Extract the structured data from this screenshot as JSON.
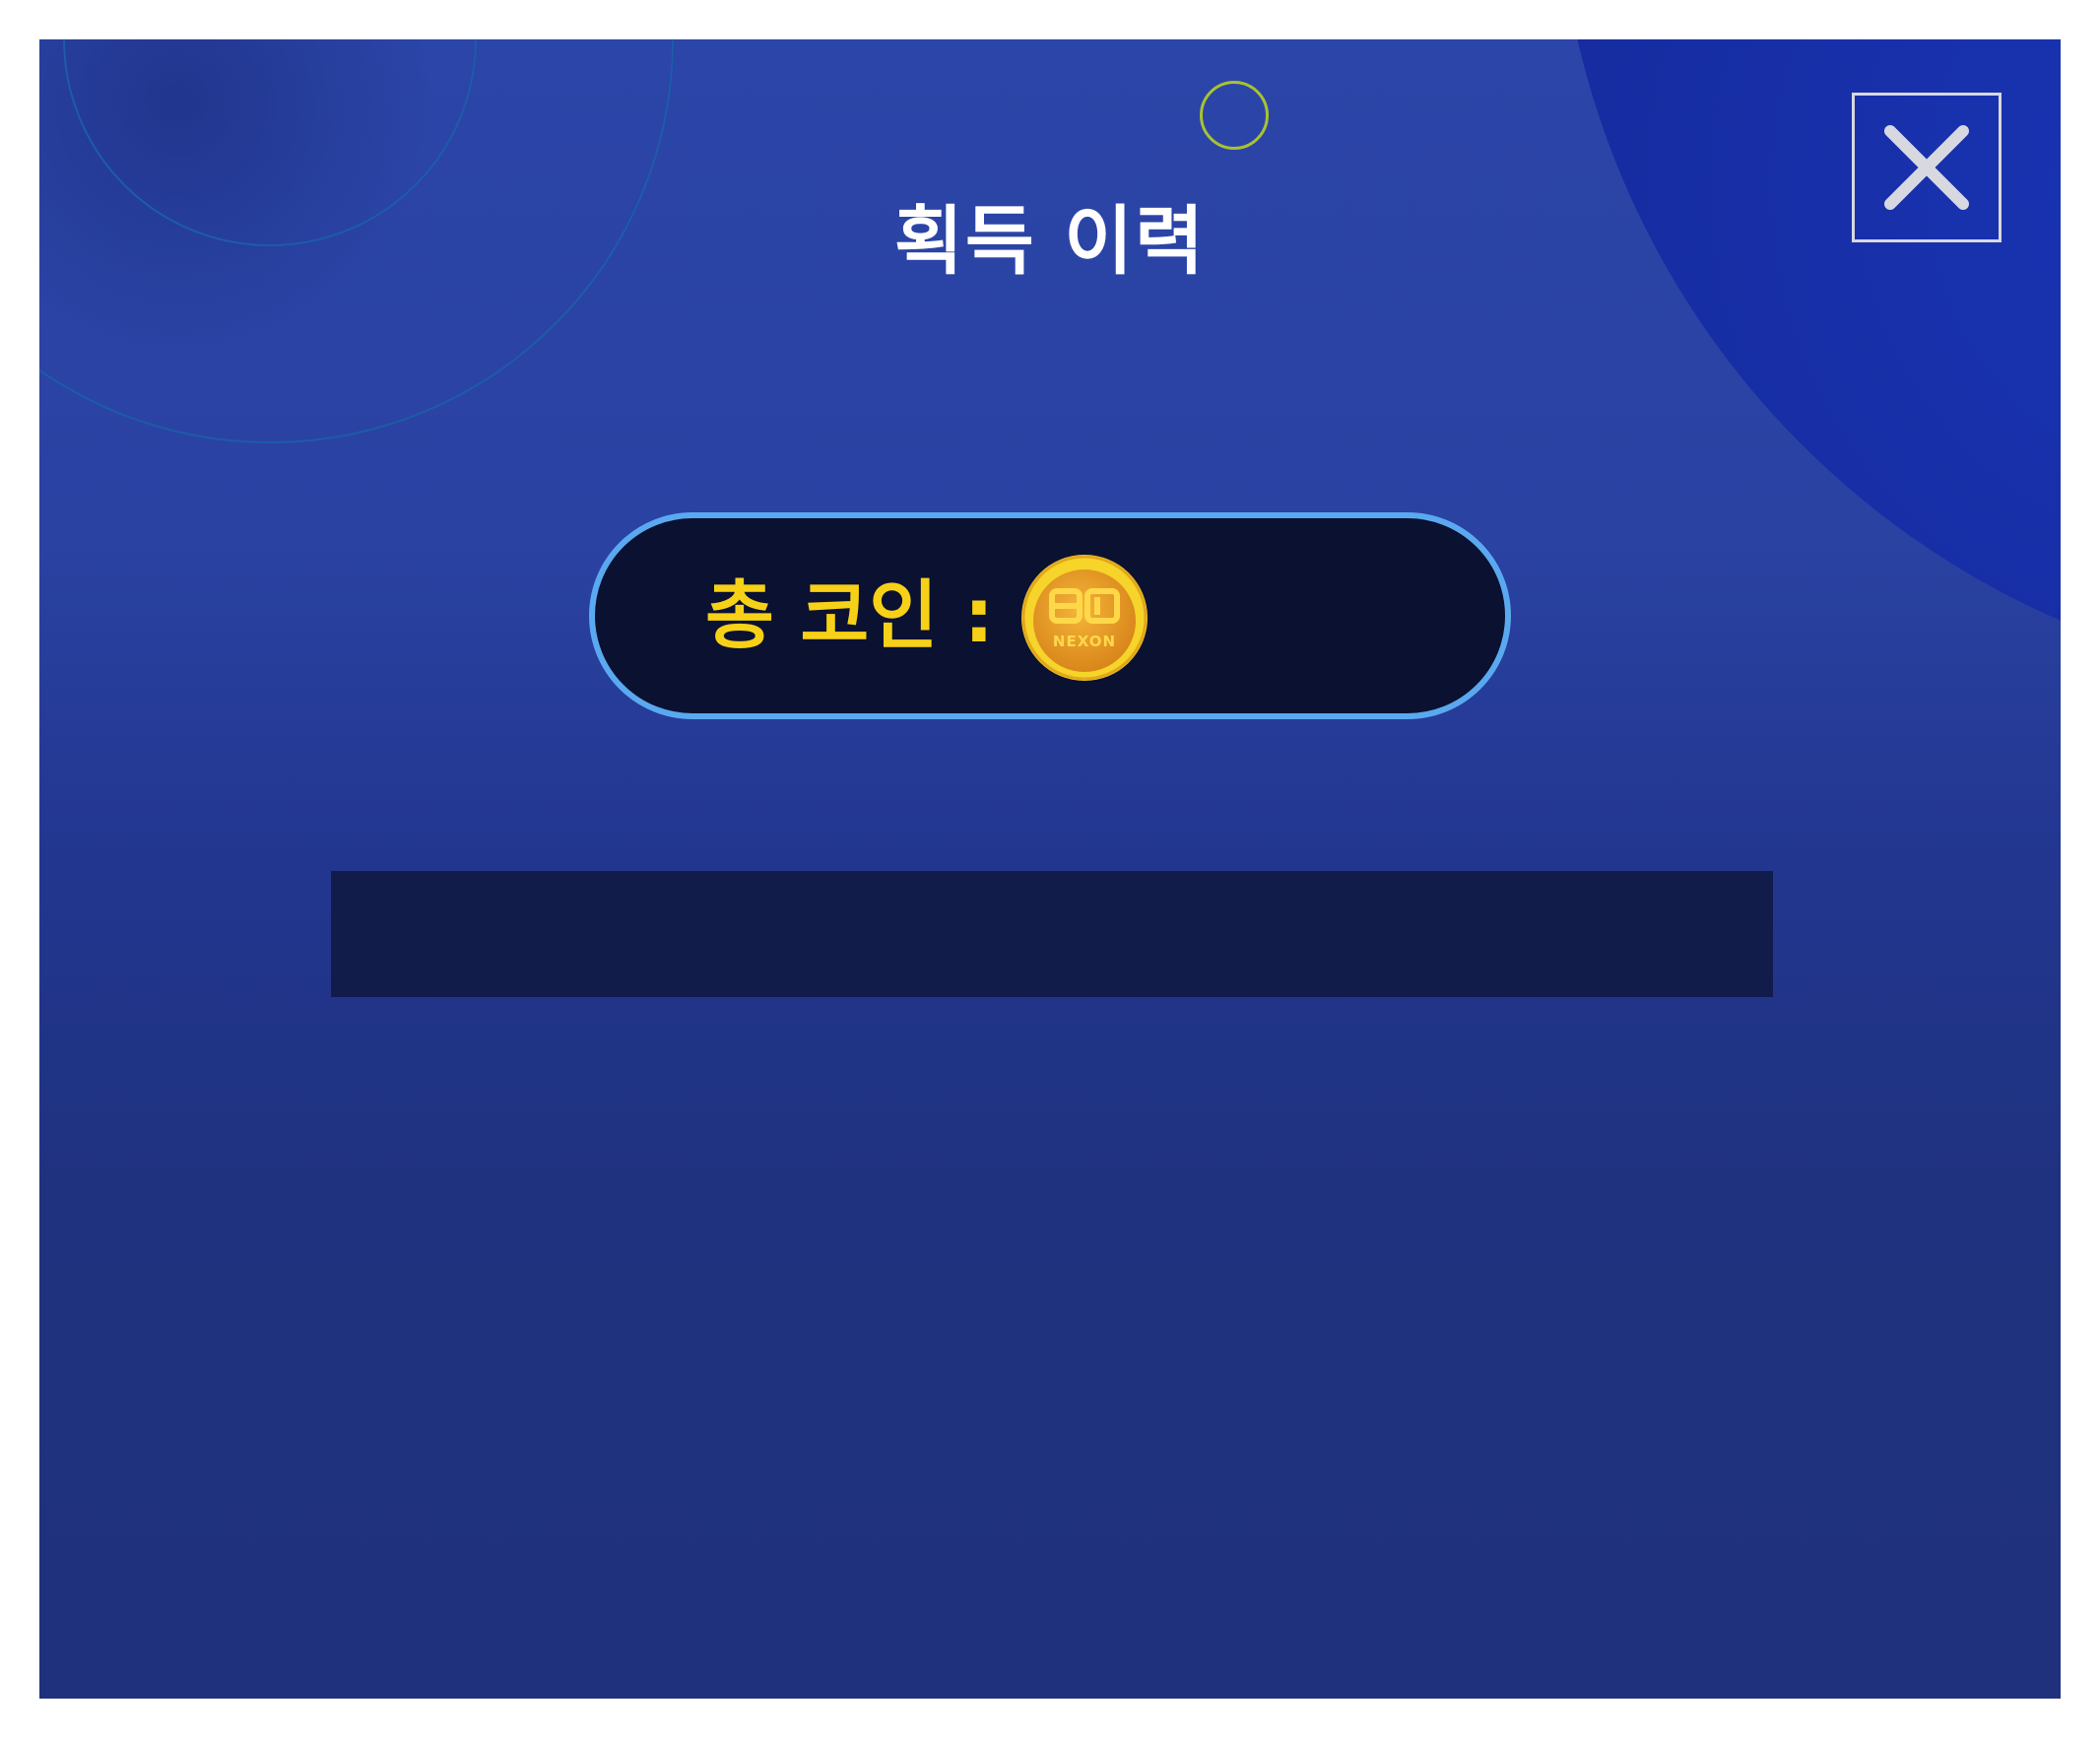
{
  "popup": {
    "title": "획득 이력",
    "close_icon": "close-x-icon"
  },
  "coins": {
    "label": "총 코인 :",
    "coin_icon": "nexon-coin-icon",
    "coin_icon_text": "NEXON",
    "total": ""
  },
  "history": {
    "rows": []
  },
  "colors": {
    "background": "#2a42a2",
    "accent_yellow": "#f7d117",
    "pill_border": "#5aa9f0",
    "pill_fill": "#0b1130",
    "history_bar": "#121c4b"
  }
}
